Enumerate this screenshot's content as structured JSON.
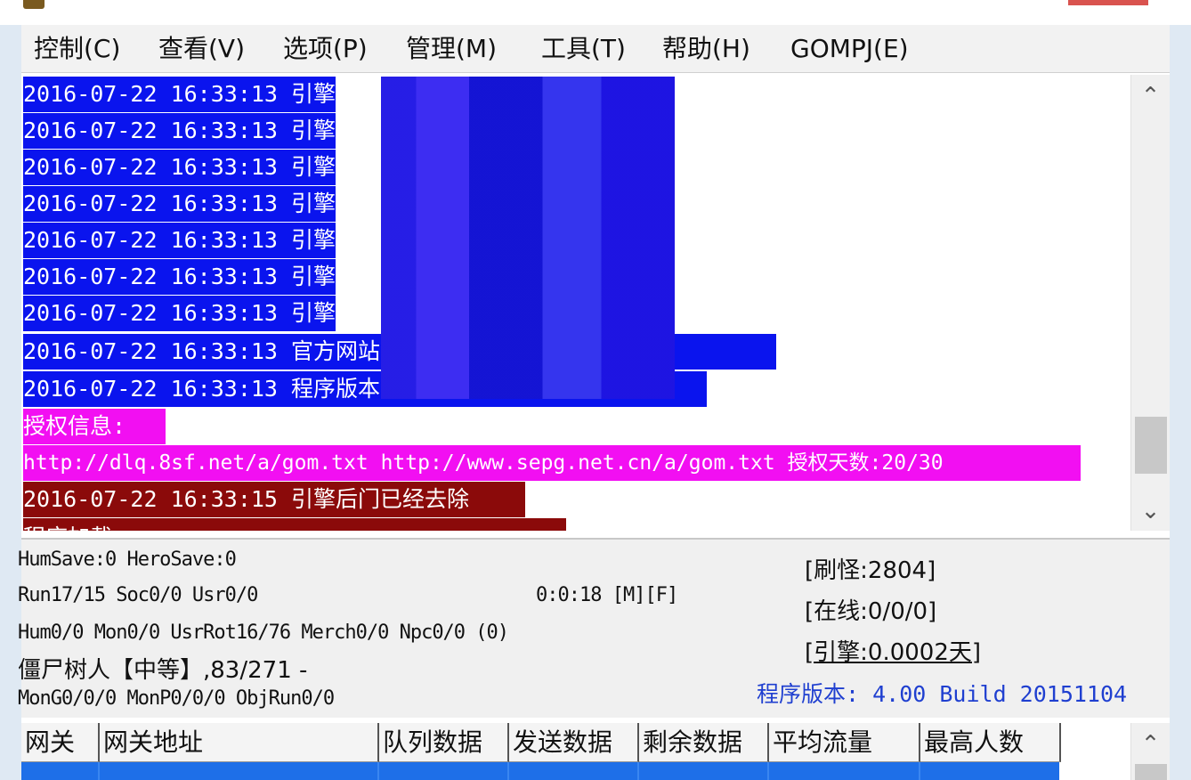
{
  "menu": {
    "items": [
      "控制(C)",
      "查看(V)",
      "选项(P)",
      "管理(M)",
      "工具(T)",
      "帮助(H)",
      "GOMPJ(E)"
    ]
  },
  "log": {
    "lines": [
      {
        "text": "2016-07-22 16:33:13 引擎",
        "style": "blue"
      },
      {
        "text": "2016-07-22 16:33:13 引擎",
        "style": "blue"
      },
      {
        "text": "2016-07-22 16:33:13 引擎",
        "style": "blue"
      },
      {
        "text": "2016-07-22 16:33:13 引擎",
        "style": "blue"
      },
      {
        "text": "2016-07-22 16:33:13 引擎",
        "style": "blue"
      },
      {
        "text": "2016-07-22 16:33:13 引擎",
        "style": "blue"
      },
      {
        "text": "2016-07-22 16:33:13 引擎",
        "style": "blue"
      },
      {
        "text": "2016-07-22 16:33:13 官方网站: http://www.g    ir.com",
        "style": "blue"
      },
      {
        "text": "2016-07-22 16:33:13 程序版本: 4.00 Build 20151104",
        "style": "blue"
      },
      {
        "text": "授权信息:",
        "style": "magenta"
      },
      {
        "text": "http://dlq.8sf.net/a/gom.txt http://www.sepg.net.cn/a/gom.txt 授权天数:20/30",
        "style": "magenta"
      },
      {
        "text": "2016-07-22 16:33:15 引擎后门已经去除",
        "style": "maroon"
      },
      {
        "text": "程序加载",
        "style": "maroon"
      }
    ]
  },
  "status": {
    "line1": "HumSave:0 HeroSave:0",
    "line2": "Run17/15 Soc0/0 Usr0/0",
    "timer": "0:0:18 [M][F]",
    "line3": "Hum0/0 Mon0/0 UsrRot16/76 Merch0/0 Npc0/0 (0)",
    "line4": "僵尸树人【中等】,83/271 -",
    "line5": "MonG0/0/0 MonP0/0/0 ObjRun0/0",
    "refresh": "[刷怪:2804]",
    "online": "[在线:0/0/0]",
    "engine": "[引擎:0.0002天]",
    "version": "程序版本: 4.00 Build 20151104"
  },
  "gate_table": {
    "columns": [
      "网关",
      "网关地址",
      "队列数据",
      "发送数据",
      "剩余数据",
      "平均流量",
      "最高人数"
    ]
  },
  "icons": {
    "scroll_up": "chevron-up-icon",
    "scroll_down": "chevron-down-icon"
  },
  "colors": {
    "log_blue": "#0a14ee",
    "log_magenta": "#f20ff2",
    "log_maroon": "#8b0a0a",
    "version_text": "#1f3fd0",
    "selected_row": "#1e6fe8"
  }
}
